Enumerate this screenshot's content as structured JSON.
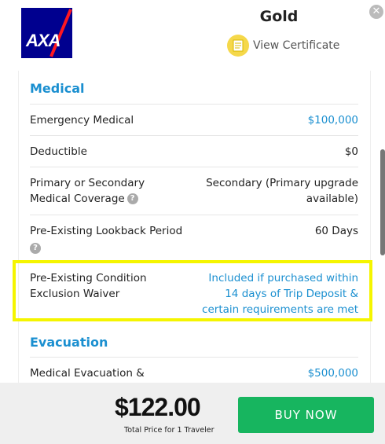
{
  "header": {
    "logo_text": "AXA",
    "plan_name": "Gold",
    "certificate_link": "View Certificate"
  },
  "sections": {
    "medical": {
      "title": "Medical",
      "rows": [
        {
          "label": "Emergency Medical",
          "value": "$100,000"
        },
        {
          "label": "Deductible",
          "value": "$0"
        },
        {
          "label_line1": "Primary or Secondary",
          "label_line2": "Medical Coverage",
          "value_line1": "Secondary (Primary upgrade",
          "value_line2": "available)"
        },
        {
          "label": "Pre-Existing Lookback Period",
          "value": "60 Days"
        },
        {
          "label_line1": "Pre-Existing Condition",
          "label_line2": "Exclusion Waiver",
          "value_line1": "Included if purchased within",
          "value_line2": "14 days of Trip Deposit &",
          "value_line3": "certain requirements are met"
        }
      ]
    },
    "evacuation": {
      "title": "Evacuation",
      "rows": [
        {
          "label": "Medical Evacuation &",
          "value": "$500,000"
        }
      ]
    }
  },
  "footer": {
    "price": "$122.00",
    "price_caption": "Total Price for 1 Traveler",
    "buy_label": "BUY NOW"
  },
  "colors": {
    "accent_blue": "#1a8fd0",
    "buy_green": "#17b55f",
    "highlight_yellow": "#f5f500",
    "axa_navy": "#00008f",
    "axa_red": "#ff1721"
  }
}
